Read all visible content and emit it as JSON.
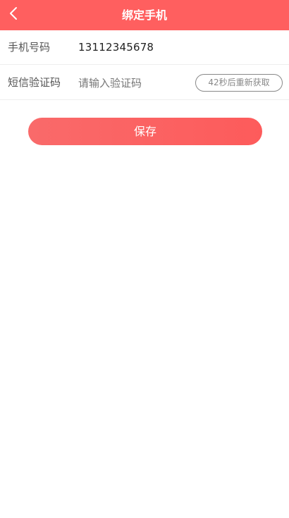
{
  "header": {
    "title": "绑定手机",
    "back_icon": "chevron-left-icon",
    "background_color": "#ff5f5f"
  },
  "form": {
    "phone": {
      "label": "手机号码",
      "value": "13112345678"
    },
    "code": {
      "label": "短信验证码",
      "placeholder": "请输入验证码",
      "resend_label": "42秒后重新获取"
    }
  },
  "actions": {
    "save_label": "保存",
    "save_color": "#fd5b5b"
  }
}
